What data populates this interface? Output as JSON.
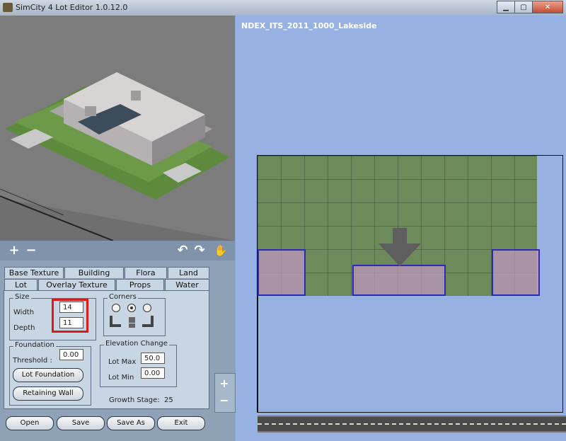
{
  "window": {
    "title": "SimCity 4 Lot Editor 1.0.12.0",
    "minimize_label": "▁",
    "maximize_label": "▢",
    "close_label": "✕"
  },
  "view": {
    "lot_name": "NDEX_ITS_2011_1000_Lakeside",
    "zoom_in_label": "+",
    "zoom_out_label": "−"
  },
  "toolbar": {
    "zoom_in_label": "+",
    "zoom_out_label": "−",
    "rotate_left_label": "↶",
    "rotate_right_label": "↷",
    "pan_label": "✋"
  },
  "tabs": {
    "row1": [
      "Base Texture",
      "Building",
      "Flora",
      "Land"
    ],
    "row2": [
      "Lot",
      "Overlay Texture",
      "Props",
      "Water"
    ],
    "active": "Lot"
  },
  "size": {
    "label": "Size",
    "width_label": "Width",
    "width_value": "14",
    "depth_label": "Depth",
    "depth_value": "11"
  },
  "corners": {
    "label": "Corners"
  },
  "foundation": {
    "label": "Foundation",
    "threshold_label": "Threshold :",
    "threshold_value": "0.00",
    "lot_foundation_label": "Lot Foundation",
    "retaining_wall_label": "Retaining Wall"
  },
  "elevation": {
    "label": "Elevation Change",
    "lot_max_label": "Lot Max",
    "lot_max_value": "50.0",
    "lot_min_label": "Lot Min",
    "lot_min_value": "0.00"
  },
  "growth": {
    "label": "Growth Stage:",
    "value": "25"
  },
  "buttons": {
    "open": "Open",
    "save": "Save",
    "save_as": "Save As",
    "exit": "Exit"
  }
}
